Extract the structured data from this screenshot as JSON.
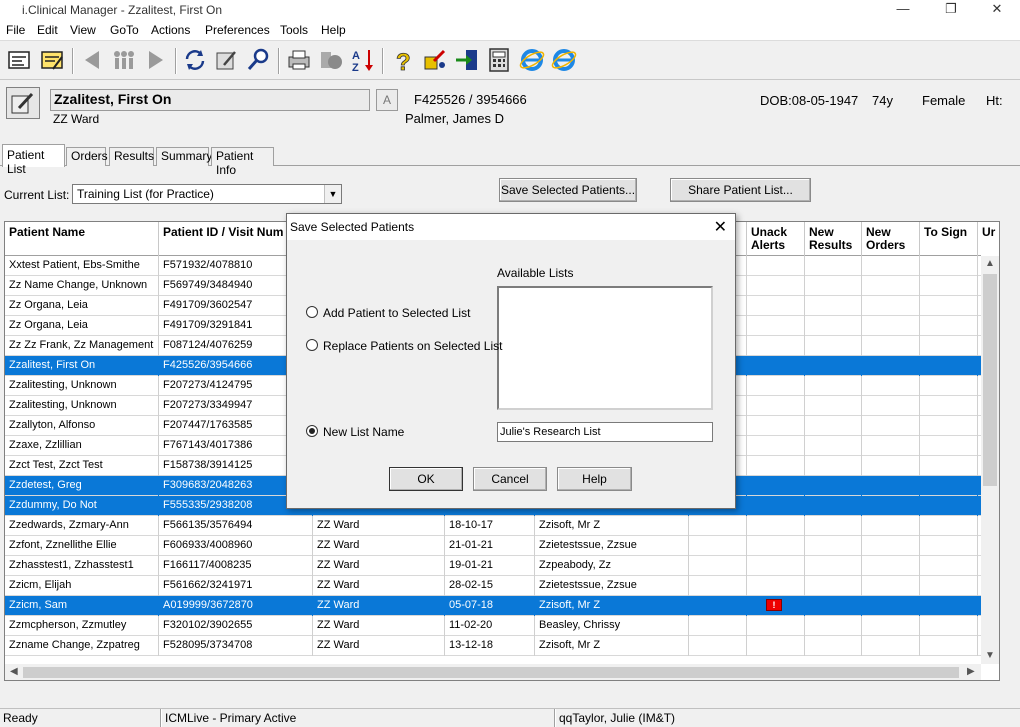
{
  "window": {
    "title": "i.Clinical Manager - Zzalitest, First On",
    "minimize": "—",
    "restore": "❐",
    "close": "✕"
  },
  "menu": [
    "File",
    "Edit",
    "View",
    "GoTo",
    "Actions",
    "Preferences",
    "Tools",
    "Help"
  ],
  "toolbar": {
    "icons": [
      "patient-card-icon",
      "patient-card-edit-icon",
      "back-arrow-icon",
      "people-icon",
      "forward-arrow-icon",
      "refresh-icon",
      "edit-icon",
      "search-icon",
      "print-icon",
      "record-icon",
      "sort-az-icon",
      "help-icon",
      "tools-icon",
      "exit-icon",
      "calculator-icon",
      "ie-icon",
      "ie-icon-2"
    ]
  },
  "patient": {
    "name": "Zzalitest, First On",
    "location": "ZZ Ward",
    "flag": "A",
    "ids": "F425526 / 3954666",
    "physician": "Palmer, James D",
    "dob": "DOB:08-05-1947",
    "age": "74y",
    "sex": "Female",
    "ht": "Ht:"
  },
  "tabs": [
    "Patient List",
    "Orders",
    "Results",
    "Summary",
    "Patient Info"
  ],
  "current_list": {
    "label": "Current List:",
    "value": "Training List (for Practice)"
  },
  "buttons": {
    "save_selected": "Save Selected Patients...",
    "share_list": "Share Patient List..."
  },
  "grid": {
    "headers": [
      "Patient Name",
      "Patient ID / Visit Num",
      "",
      "",
      "",
      "",
      "Unack Alerts",
      "New Results",
      "New Orders",
      "To Sign",
      "Ur"
    ],
    "rows": [
      {
        "name": "Xxtest Patient, Ebs-Smithe",
        "id": "F571932/4078810",
        "loc": "",
        "date": "",
        "doc": "",
        "sel": false,
        "alert": false
      },
      {
        "name": "Zz Name Change, Unknown",
        "id": "F569749/3484940",
        "loc": "",
        "date": "",
        "doc": "",
        "sel": false,
        "alert": false
      },
      {
        "name": "Zz Organa, Leia",
        "id": "F491709/3602547",
        "loc": "",
        "date": "",
        "doc": "",
        "sel": false,
        "alert": false
      },
      {
        "name": "Zz Organa, Leia",
        "id": "F491709/3291841",
        "loc": "",
        "date": "",
        "doc": "",
        "sel": false,
        "alert": false
      },
      {
        "name": "Zz Zz Frank, Zz Management",
        "id": "F087124/4076259",
        "loc": "",
        "date": "",
        "doc": "",
        "sel": false,
        "alert": false
      },
      {
        "name": "Zzalitest, First On",
        "id": "F425526/3954666",
        "loc": "",
        "date": "",
        "doc": "",
        "sel": true,
        "alert": false
      },
      {
        "name": "Zzalitesting, Unknown",
        "id": "F207273/4124795",
        "loc": "",
        "date": "",
        "doc": "",
        "sel": false,
        "alert": false
      },
      {
        "name": "Zzalitesting, Unknown",
        "id": "F207273/3349947",
        "loc": "",
        "date": "",
        "doc": "",
        "sel": false,
        "alert": false
      },
      {
        "name": "Zzallyton, Alfonso",
        "id": "F207447/1763585",
        "loc": "",
        "date": "",
        "doc": "",
        "sel": false,
        "alert": false
      },
      {
        "name": "Zzaxe, Zzlillian",
        "id": "F767143/4017386",
        "loc": "",
        "date": "",
        "doc": "",
        "sel": false,
        "alert": false
      },
      {
        "name": "Zzct Test, Zzct Test",
        "id": "F158738/3914125",
        "loc": "",
        "date": "",
        "doc": "",
        "sel": false,
        "alert": false
      },
      {
        "name": "Zzdetest, Greg",
        "id": "F309683/2048263",
        "loc": "",
        "date": "",
        "doc": "",
        "sel": true,
        "alert": false
      },
      {
        "name": "Zzdummy, Do Not",
        "id": "F555335/2938208",
        "loc": "",
        "date": "",
        "doc": "",
        "sel": true,
        "alert": false
      },
      {
        "name": "Zzedwards, Zzmary-Ann",
        "id": "F566135/3576494",
        "loc": "ZZ Ward",
        "date": "18-10-17",
        "doc": "Zzisoft, Mr Z",
        "sel": false,
        "alert": false
      },
      {
        "name": "Zzfont, Zznellithe Ellie",
        "id": "F606933/4008960",
        "loc": "ZZ Ward",
        "date": "21-01-21",
        "doc": "Zzietestssue, Zzsue",
        "sel": false,
        "alert": false
      },
      {
        "name": "Zzhasstest1, Zzhasstest1",
        "id": "F166117/4008235",
        "loc": "ZZ Ward",
        "date": "19-01-21",
        "doc": "Zzpeabody, Zz",
        "sel": false,
        "alert": false
      },
      {
        "name": "Zzicm, Elijah",
        "id": "F561662/3241971",
        "loc": "ZZ Ward",
        "date": "28-02-15",
        "doc": "Zzietestssue, Zzsue",
        "sel": false,
        "alert": false
      },
      {
        "name": "Zzicm, Sam",
        "id": "A019999/3672870",
        "loc": "ZZ Ward",
        "date": "05-07-18",
        "doc": "Zzisoft, Mr Z",
        "sel": true,
        "alert": true
      },
      {
        "name": "Zzmcpherson, Zzmutley",
        "id": "F320102/3902655",
        "loc": "ZZ Ward",
        "date": "11-02-20",
        "doc": "Beasley, Chrissy",
        "sel": false,
        "alert": false
      },
      {
        "name": "Zzname Change, Zzpatreg",
        "id": "F528095/3734708",
        "loc": "ZZ Ward",
        "date": "13-12-18",
        "doc": "Zzisoft, Mr Z",
        "sel": false,
        "alert": false
      }
    ]
  },
  "status": {
    "ready": "Ready",
    "system": "ICMLive - Primary Active",
    "user": "qqTaylor, Julie (IM&T)"
  },
  "dialog": {
    "title": "Save Selected Patients",
    "available_label": "Available Lists",
    "opt_add": "Add Patient to Selected List",
    "opt_replace": "Replace Patients on Selected List",
    "opt_new": "New List Name",
    "new_name_value": "Julie's Research List",
    "ok": "OK",
    "cancel": "Cancel",
    "help": "Help"
  },
  "colors": {
    "selection": "#0a78d7",
    "alert": "#e00000"
  }
}
